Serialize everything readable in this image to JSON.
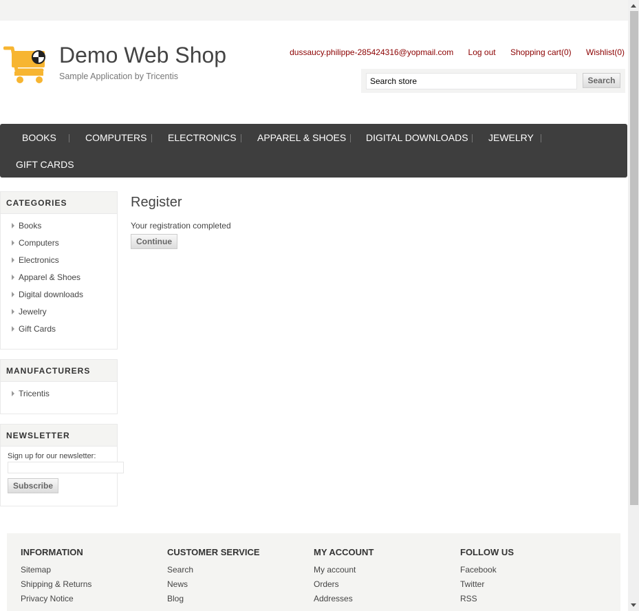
{
  "header": {
    "title": "Demo Web Shop",
    "subtitle": "Sample Application by Tricentis",
    "links": {
      "account": "dussaucy.philippe-285424316@yopmail.com",
      "logout": "Log out",
      "cart": "Shopping cart(0)",
      "wishlist": "Wishlist(0)"
    },
    "search": {
      "value": "Search store",
      "button": "Search"
    }
  },
  "menu": {
    "items": [
      "BOOKS",
      "COMPUTERS",
      "ELECTRONICS",
      "APPAREL & SHOES",
      "DIGITAL DOWNLOADS",
      "JEWELRY",
      "GIFT CARDS"
    ]
  },
  "sidebar": {
    "categories": {
      "title": "CATEGORIES",
      "items": [
        "Books",
        "Computers",
        "Electronics",
        "Apparel & Shoes",
        "Digital downloads",
        "Jewelry",
        "Gift Cards"
      ]
    },
    "manufacturers": {
      "title": "MANUFACTURERS",
      "items": [
        "Tricentis"
      ]
    },
    "newsletter": {
      "title": "NEWSLETTER",
      "label": "Sign up for our newsletter:",
      "button": "Subscribe"
    }
  },
  "main": {
    "title": "Register",
    "result": "Your registration completed",
    "continue": "Continue"
  },
  "footer": {
    "columns": [
      {
        "title": "INFORMATION",
        "links": [
          "Sitemap",
          "Shipping & Returns",
          "Privacy Notice"
        ]
      },
      {
        "title": "CUSTOMER SERVICE",
        "links": [
          "Search",
          "News",
          "Blog"
        ]
      },
      {
        "title": "MY ACCOUNT",
        "links": [
          "My account",
          "Orders",
          "Addresses"
        ]
      },
      {
        "title": "FOLLOW US",
        "links": [
          "Facebook",
          "Twitter",
          "RSS"
        ]
      }
    ]
  },
  "colors": {
    "link": "#8b0000",
    "menu_bg": "#3e3e3e",
    "logo": "#f7b531"
  },
  "icons": {
    "logo": "shopping-cart-icon",
    "list_bullet": "triangle-right-icon"
  }
}
